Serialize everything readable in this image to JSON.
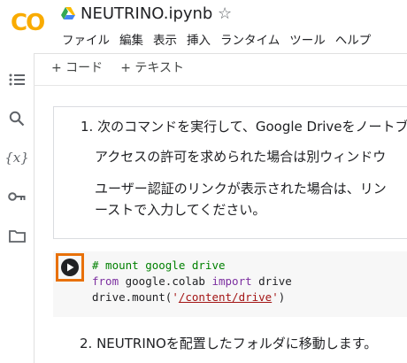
{
  "header": {
    "title": "NEUTRINO.ipynb",
    "menu": [
      "ファイル",
      "編集",
      "表示",
      "挿入",
      "ランタイム",
      "ツール",
      "ヘルプ"
    ],
    "logo_icon": "colab-logo",
    "star_icon": "star-icon"
  },
  "toolbar": {
    "add_code": "+ コード",
    "add_text": "+ テキスト"
  },
  "sidebar": {
    "icons": [
      "toc-icon",
      "search-icon",
      "variables-icon",
      "key-icon",
      "folder-icon"
    ]
  },
  "text_cell": {
    "line1": "1. 次のコマンドを実行して、Google Driveをノートブ",
    "line2": "アクセスの許可を求められた場合は別ウィンドウ",
    "line3": "ユーザー認証のリンクが表示された場合は、リン",
    "line4": "ーストで入力してください。"
  },
  "code_cell": {
    "comment": "# mount google drive",
    "kw_from": "from",
    "module": " google.colab ",
    "kw_import": "import",
    "import_name": " drive",
    "call_prefix": "drive.mount(",
    "quote_open": "'",
    "path": "/content/drive",
    "quote_close": "'",
    "call_suffix": ")"
  },
  "next_text": "2. NEUTRINOを配置したフォルダに移動します。",
  "colors": {
    "logo": "#f9ab00",
    "run_highlight": "#e8710a",
    "comment": "#008000",
    "keyword": "#7c2fa0",
    "string": "#a31515"
  }
}
